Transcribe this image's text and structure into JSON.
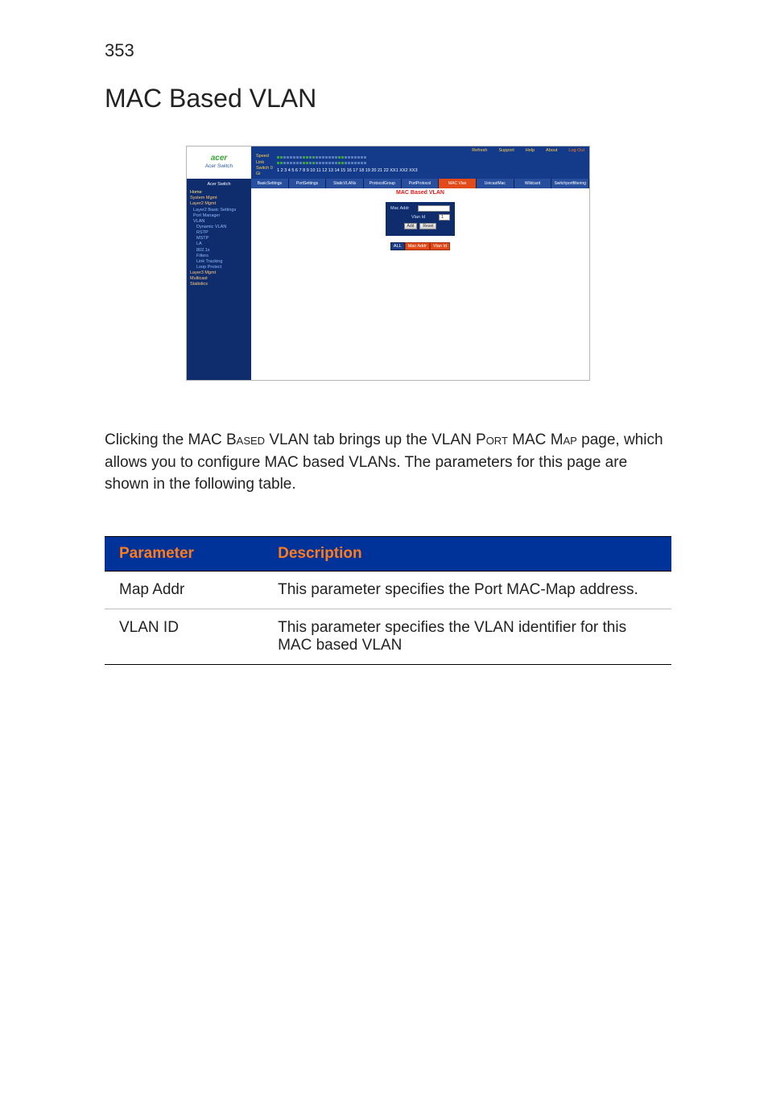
{
  "page_number": "353",
  "page_title": "MAC Based VLAN",
  "screenshot": {
    "logo": {
      "brand": "acer",
      "sub": "Acer Switch"
    },
    "top_links": [
      "Refresh",
      "Support",
      "Help",
      "About",
      "Log Out"
    ],
    "port_rows": {
      "speed": "Speed",
      "link": "Link",
      "switch_prefix": "Switch 0 Gi"
    },
    "sidebar": {
      "header": "Acer Switch",
      "home": "Home",
      "groups": [
        "System Mgmt",
        "Layer2 Mgmt"
      ],
      "subs": [
        "Layer2 Basic Settings",
        "Port Manager",
        "VLAN",
        "Dynamic VLAN",
        "RSTP",
        "MSTP",
        "LA",
        "802.1x",
        "Filters",
        "Link Tracking",
        "Loop Protect"
      ],
      "groups_tail": [
        "Layer3 Mgmt",
        "Multicast",
        "Statistics"
      ]
    },
    "tabs": [
      "BasicSettings",
      "PortSettings",
      "StaticVLANs",
      "ProtocolGroup",
      "PortProtocol",
      "MAC Vlan",
      "UnicastMac",
      "Wildcard",
      "Switchportfiltering"
    ],
    "panel_title": "MAC Based VLAN",
    "form": {
      "mac_label": "Mac Addr",
      "mac_value": "",
      "vlan_label": "Vlan Id",
      "vlan_value": "1",
      "btn_add": "Add",
      "btn_reset": "Reset"
    },
    "result_headers": [
      "ALL",
      "Mac Addr",
      "Vlan Id"
    ]
  },
  "body_text": {
    "pre": "Clicking the MAC ",
    "sc1": "Based",
    "mid1": " VLAN tab brings up the VLAN ",
    "sc2": "Port",
    "mid2": " MAC ",
    "sc3": "Map",
    "post": " page, which allows you to configure MAC based VLANs. The parameters for this page are shown in the following table."
  },
  "param_table": {
    "headers": {
      "param": "Parameter",
      "desc": "Description"
    },
    "rows": [
      {
        "param": "Map Addr",
        "desc": "This parameter specifies the Port MAC-Map address."
      },
      {
        "param": "VLAN ID",
        "desc": "This parameter specifies the VLAN identifier for this MAC based VLAN"
      }
    ]
  }
}
